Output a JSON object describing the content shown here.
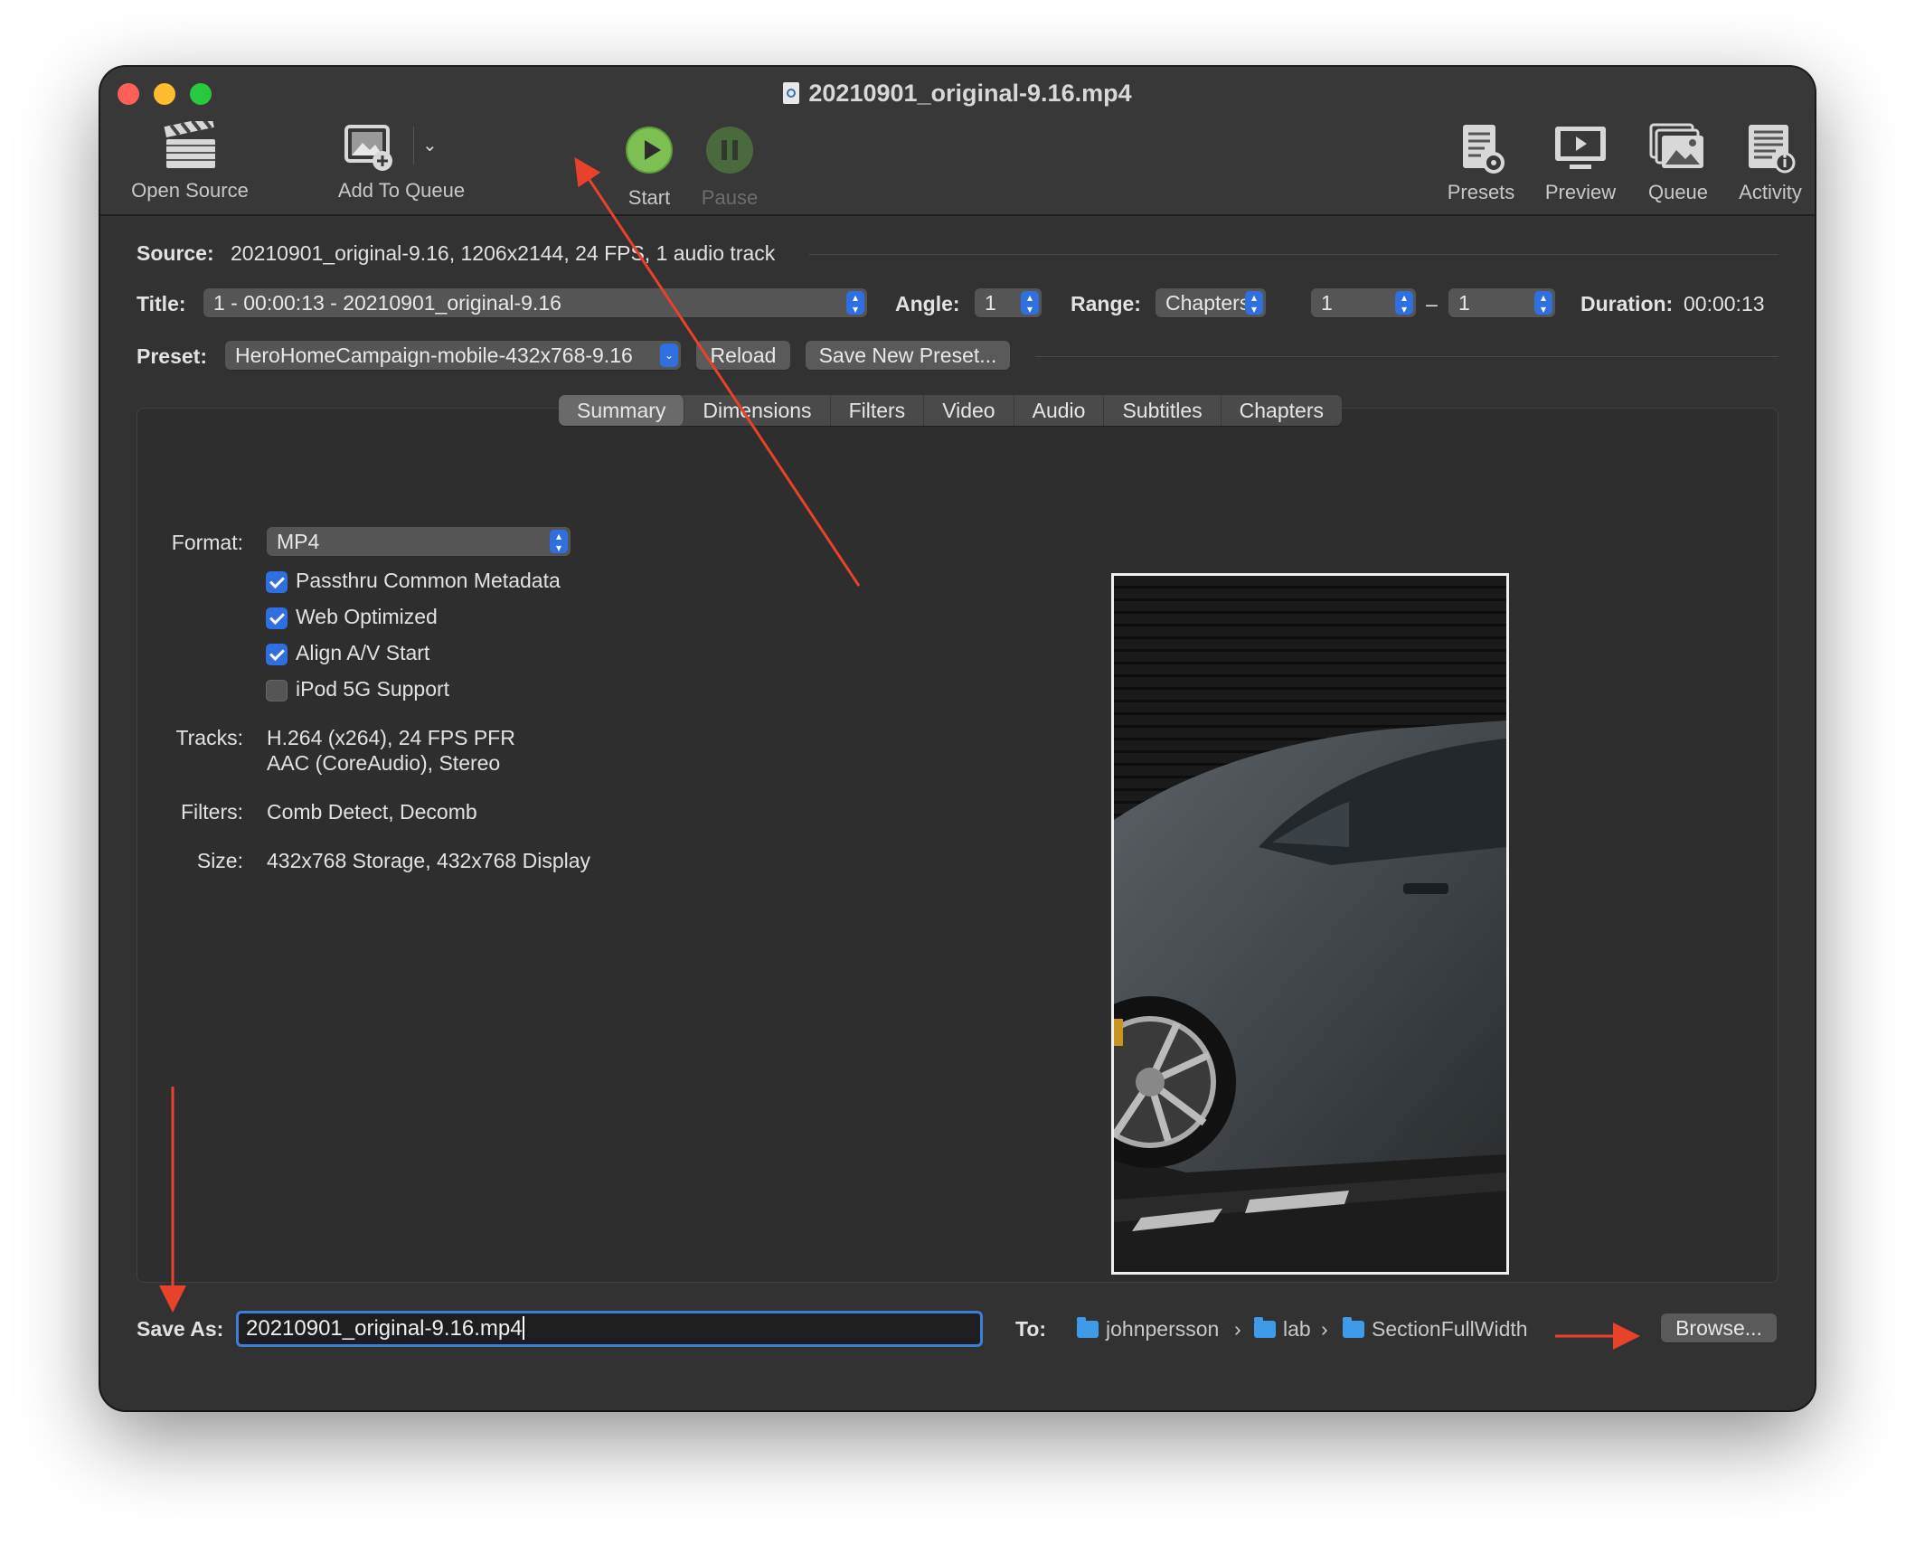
{
  "window": {
    "title": "20210901_original-9.16.mp4"
  },
  "toolbar": {
    "open_source": "Open Source",
    "add_to_queue": "Add To Queue",
    "start": "Start",
    "pause": "Pause",
    "presets": "Presets",
    "preview": "Preview",
    "queue": "Queue",
    "activity": "Activity"
  },
  "source": {
    "label": "Source:",
    "value": "20210901_original-9.16, 1206x2144, 24 FPS, 1 audio track"
  },
  "title_row": {
    "title_label": "Title:",
    "title_value": "1 - 00:00:13 - 20210901_original-9.16",
    "angle_label": "Angle:",
    "angle_value": "1",
    "range_label": "Range:",
    "range_value": "Chapters",
    "range_start": "1",
    "range_dash": "–",
    "range_end": "1",
    "duration_label": "Duration:",
    "duration_value": "00:00:13"
  },
  "preset_row": {
    "label": "Preset:",
    "value": "HeroHomeCampaign-mobile-432x768-9.16",
    "reload": "Reload",
    "save_new": "Save New Preset..."
  },
  "tabs": [
    "Summary",
    "Dimensions",
    "Filters",
    "Video",
    "Audio",
    "Subtitles",
    "Chapters"
  ],
  "active_tab": "Summary",
  "summary": {
    "format_label": "Format:",
    "format_value": "MP4",
    "checkboxes": [
      {
        "label": "Passthru Common Metadata",
        "checked": true
      },
      {
        "label": "Web Optimized",
        "checked": true
      },
      {
        "label": "Align A/V Start",
        "checked": true
      },
      {
        "label": "iPod 5G Support",
        "checked": false
      }
    ],
    "tracks_label": "Tracks:",
    "tracks_line1": "H.264 (x264), 24 FPS PFR",
    "tracks_line2": "AAC (CoreAudio), Stereo",
    "filters_label": "Filters:",
    "filters_value": "Comb Detect, Decomb",
    "size_label": "Size:",
    "size_value": "432x768 Storage, 432x768 Display"
  },
  "save": {
    "label": "Save As:",
    "filename": "20210901_original-9.16.mp4",
    "to_label": "To:",
    "path": [
      "johnpersson",
      "lab",
      "SectionFullWidth"
    ],
    "path_sep": "›",
    "browse": "Browse..."
  },
  "colors": {
    "accent": "#2f6fe0",
    "annotation_arrow": "#e8412c",
    "start_green": "#7dbf52",
    "folder_blue": "#3f9bea"
  }
}
